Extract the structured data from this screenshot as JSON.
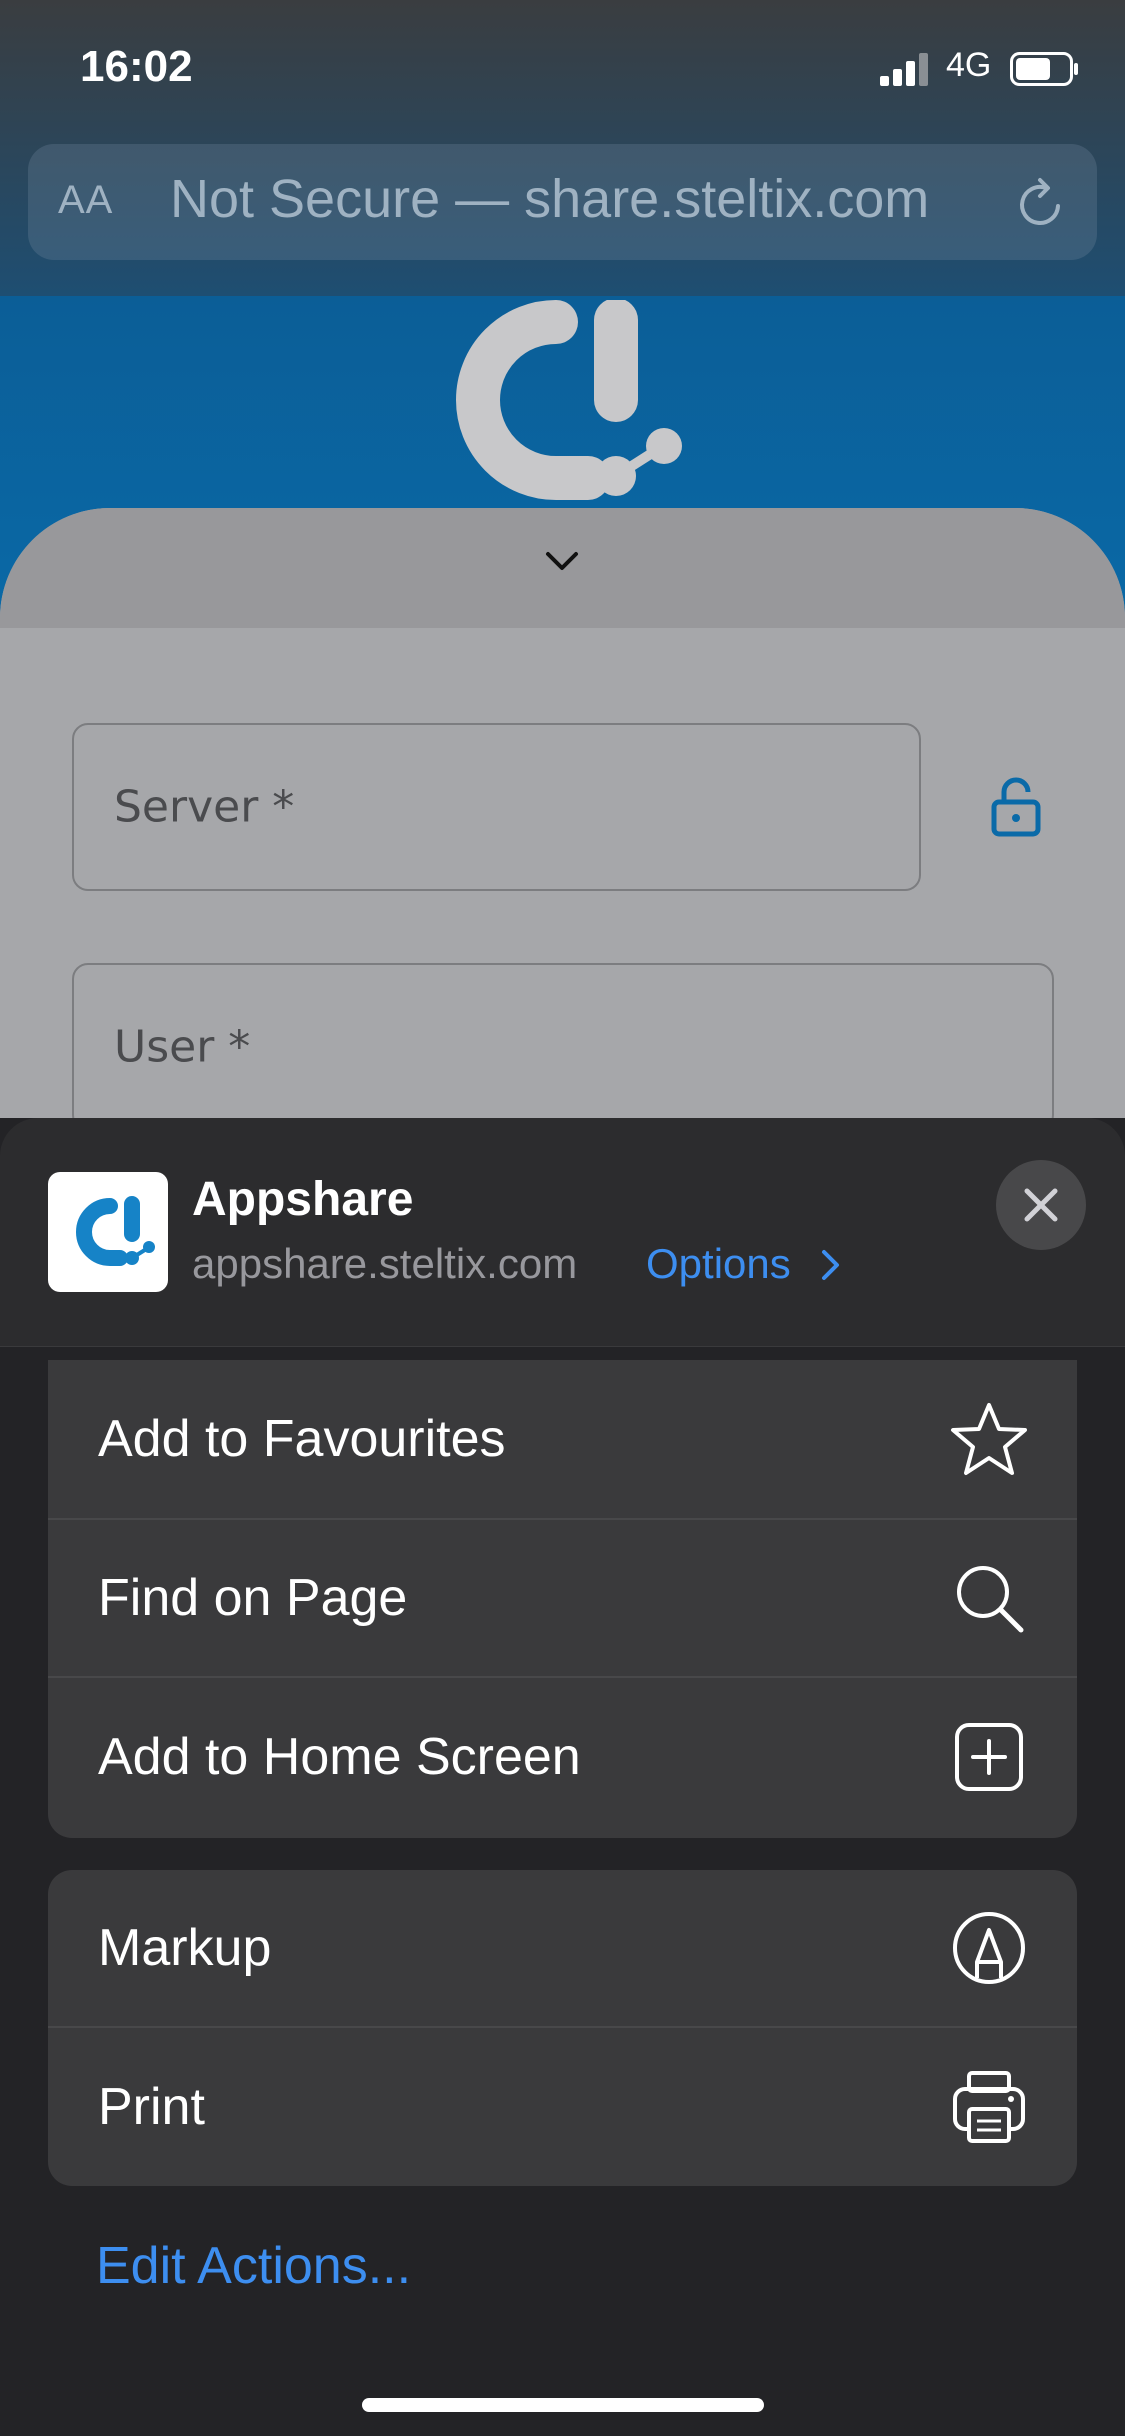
{
  "status_bar": {
    "time": "16:02",
    "network": "4G"
  },
  "address_bar": {
    "text_size_label": "AA",
    "url_text": "Not Secure — share.steltix.com"
  },
  "page": {
    "server_placeholder": "Server *",
    "user_placeholder": "User *"
  },
  "share_sheet": {
    "app_name": "Appshare",
    "app_url": "appshare.steltix.com",
    "options_label": "Options",
    "actions_group1": [
      {
        "label": "Add to Favourites",
        "icon": "star-icon"
      },
      {
        "label": "Find on Page",
        "icon": "search-icon"
      },
      {
        "label": "Add to Home Screen",
        "icon": "plus-square-icon"
      }
    ],
    "actions_group2": [
      {
        "label": "Markup",
        "icon": "markup-pen-icon"
      },
      {
        "label": "Print",
        "icon": "printer-icon"
      }
    ],
    "edit_actions_label": "Edit Actions..."
  },
  "colors": {
    "accent": "#3d8ef0",
    "brand_blue": "#0a6aa8",
    "sheet_bg": "#2c2c2e",
    "row_bg": "#3a3a3c"
  }
}
